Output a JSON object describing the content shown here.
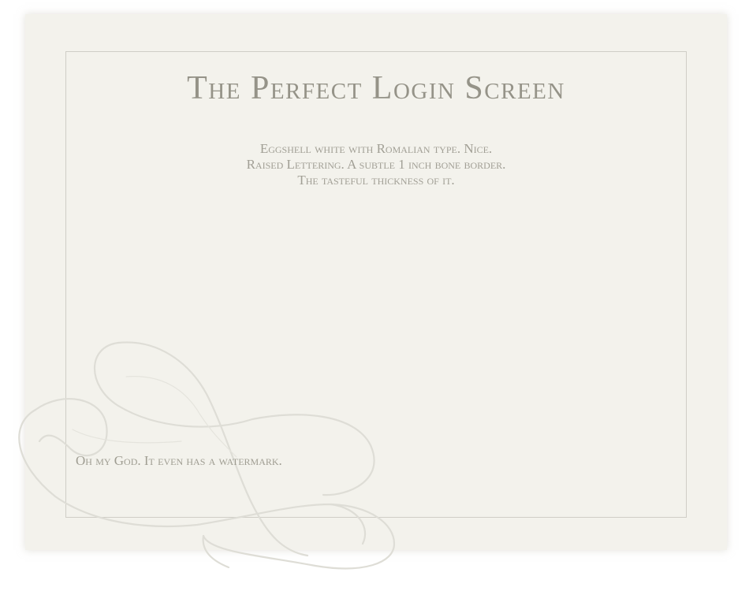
{
  "page": {
    "title": "The Perfect Login Screen",
    "subtitle_lines": [
      "Eggshell white with Romalian type. Nice.",
      "Raised Lettering. A subtle 1 inch bone border.",
      "The tasteful thickness of it."
    ],
    "watermark_caption": "Oh my God. It even has a watermark."
  },
  "colors": {
    "card_background": "#f3f2ec",
    "border": "#cfcdc6",
    "title_text": "#959388",
    "body_text": "#a19f95",
    "watermark_stroke": "#deddd6"
  },
  "decorations": {
    "watermark_icon": "flourish-swirl-icon"
  }
}
